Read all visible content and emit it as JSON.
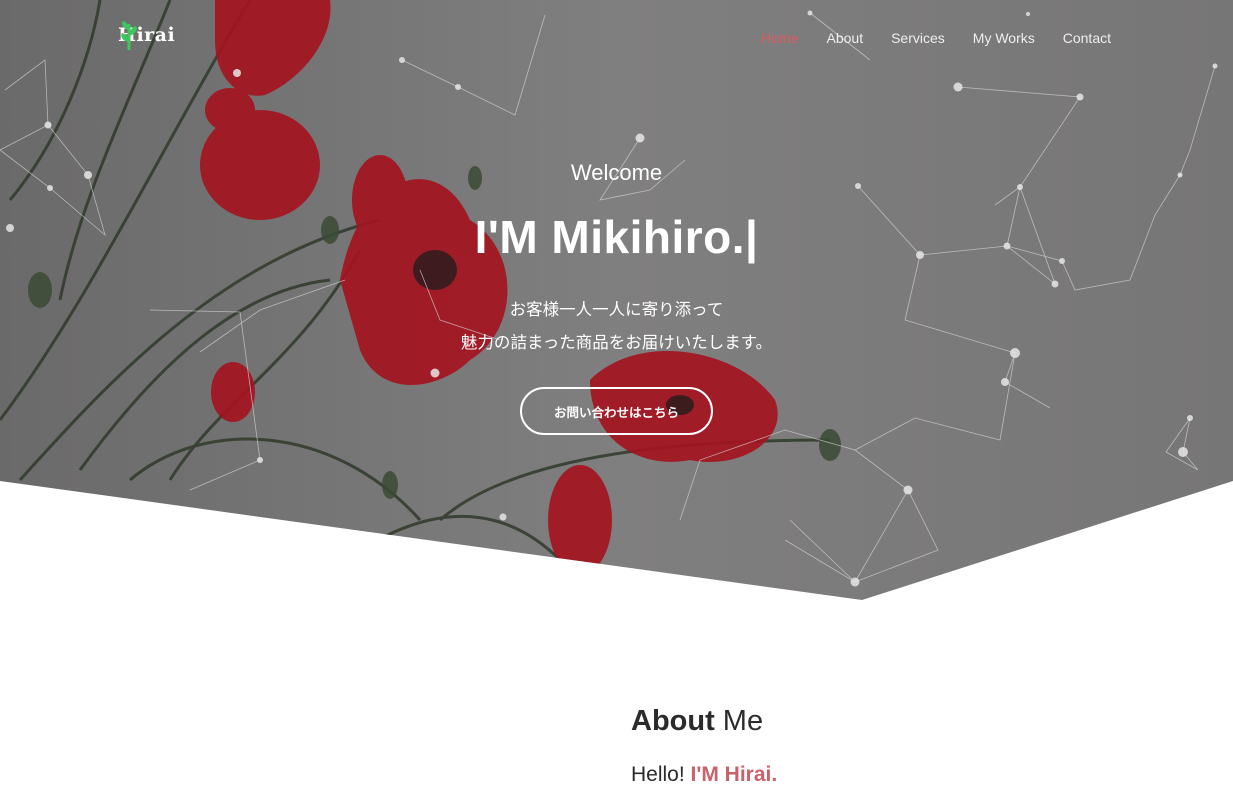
{
  "header": {
    "logo_text": "Hirai",
    "logo_icon": "green-plant-icon",
    "nav": [
      {
        "label": "Home",
        "active": true
      },
      {
        "label": "About",
        "active": false
      },
      {
        "label": "Services",
        "active": false
      },
      {
        "label": "My Works",
        "active": false
      },
      {
        "label": "Contact",
        "active": false
      }
    ]
  },
  "hero": {
    "background": "red poppy flowers photo with network-line overlay",
    "welcome": "Welcome",
    "headline": "I'M Mikihiro.|",
    "tagline_line1": "お客様一人一人に寄り添って",
    "tagline_line2": "魅力の詰まった商品をお届けいたします。",
    "cta_label": "お問い合わせはこちら"
  },
  "about": {
    "title_bold": "About",
    "title_rest": " Me",
    "greeting": "Hello! ",
    "greeting_accent": "I'M Hirai."
  },
  "colors": {
    "accent": "#e05b63",
    "accent_text": "#c9616a",
    "hero_overlay": "#7b7a7a",
    "logo_green": "#3cc65b"
  }
}
